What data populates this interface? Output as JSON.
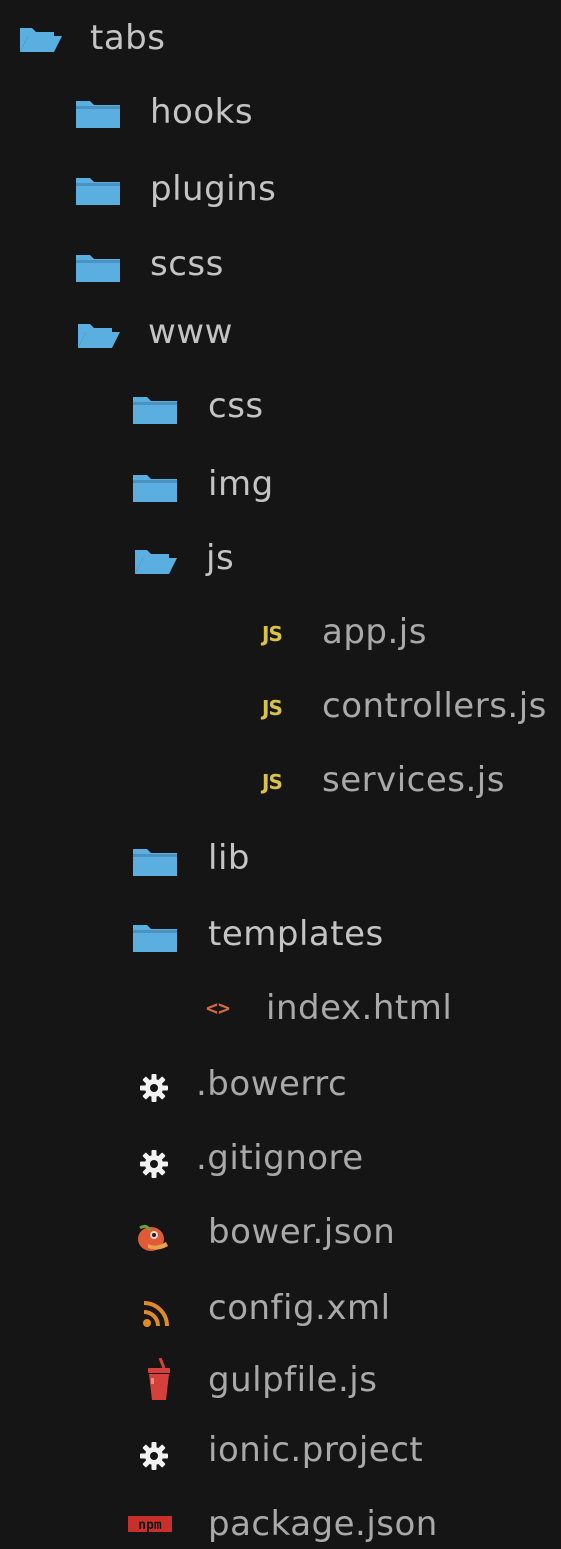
{
  "tree": {
    "root": {
      "label": "tabs",
      "icon": "folder-open-icon"
    },
    "hooks": {
      "label": "hooks",
      "icon": "folder-icon"
    },
    "plugins": {
      "label": "plugins",
      "icon": "folder-icon"
    },
    "scss": {
      "label": "scss",
      "icon": "folder-icon"
    },
    "www": {
      "label": "www",
      "icon": "folder-open-icon"
    },
    "css": {
      "label": "css",
      "icon": "folder-icon"
    },
    "img": {
      "label": "img",
      "icon": "folder-icon"
    },
    "js": {
      "label": "js",
      "icon": "folder-open-icon"
    },
    "app_js": {
      "label": "app.js",
      "icon": "javascript-file-icon",
      "badge": "JS"
    },
    "controllers_js": {
      "label": "controllers.js",
      "icon": "javascript-file-icon",
      "badge": "JS"
    },
    "services_js": {
      "label": "services.js",
      "icon": "javascript-file-icon",
      "badge": "JS"
    },
    "lib": {
      "label": "lib",
      "icon": "folder-icon"
    },
    "templates": {
      "label": "templates",
      "icon": "folder-icon"
    },
    "index_html": {
      "label": "index.html",
      "icon": "html-file-icon",
      "badge": "<>"
    },
    "bowerrc": {
      "label": ".bowerrc",
      "icon": "gear-icon"
    },
    "gitignore": {
      "label": ".gitignore",
      "icon": "gear-icon"
    },
    "bower_json": {
      "label": "bower.json",
      "icon": "bower-icon"
    },
    "config_xml": {
      "label": "config.xml",
      "icon": "rss-icon"
    },
    "gulpfile_js": {
      "label": "gulpfile.js",
      "icon": "gulp-cup-icon"
    },
    "ionic_project": {
      "label": "ionic.project",
      "icon": "gear-icon"
    },
    "package_json": {
      "label": "package.json",
      "icon": "npm-icon",
      "badge": "npm"
    }
  },
  "colors": {
    "background": "#151515",
    "folder": "#5aaee0",
    "text": "#c4c4c4",
    "js_badge": "#d9c246",
    "html_badge": "#d36a3f",
    "npm_badge": "#c8312b",
    "gulp_cup": "#d6403a",
    "rss": "#e08a2a",
    "bower": "#e05a37"
  }
}
